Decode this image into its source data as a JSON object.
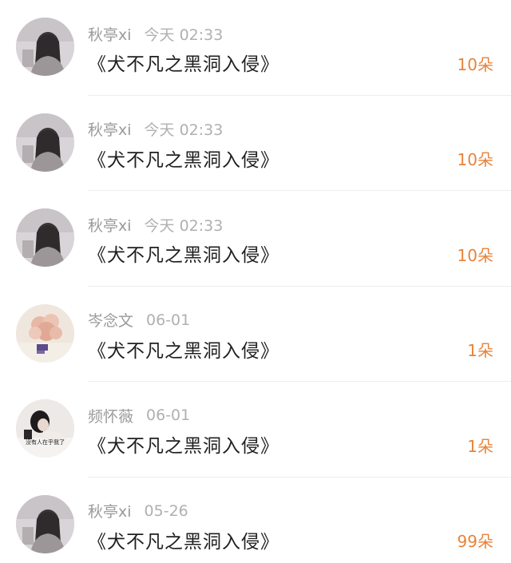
{
  "items": [
    {
      "name": "秋亭xi",
      "time": "今天 02:33",
      "title": "《犬不凡之黑洞入侵》",
      "amount": "10朵",
      "avatar": "girl-bw-avatar"
    },
    {
      "name": "秋亭xi",
      "time": "今天 02:33",
      "title": "《犬不凡之黑洞入侵》",
      "amount": "10朵",
      "avatar": "girl-bw-avatar"
    },
    {
      "name": "秋亭xi",
      "time": "今天 02:33",
      "title": "《犬不凡之黑洞入侵》",
      "amount": "10朵",
      "avatar": "girl-bw-avatar"
    },
    {
      "name": "岑念文",
      "time": "06-01",
      "title": "《犬不凡之黑洞入侵》",
      "amount": "1朵",
      "avatar": "flower-avatar"
    },
    {
      "name": "频怀薇",
      "time": "06-01",
      "title": "《犬不凡之黑洞入侵》",
      "amount": "1朵",
      "avatar": "girl-caption-avatar",
      "avatar_caption": "没有人在乎我了"
    },
    {
      "name": "秋亭xi",
      "time": "05-26",
      "title": "《犬不凡之黑洞入侵》",
      "amount": "99朵",
      "avatar": "girl-bw-avatar"
    }
  ],
  "colors": {
    "amount": "#e8833a",
    "meta": "#a3a3a3",
    "title": "#1f1f1f",
    "divider": "#ededed"
  }
}
